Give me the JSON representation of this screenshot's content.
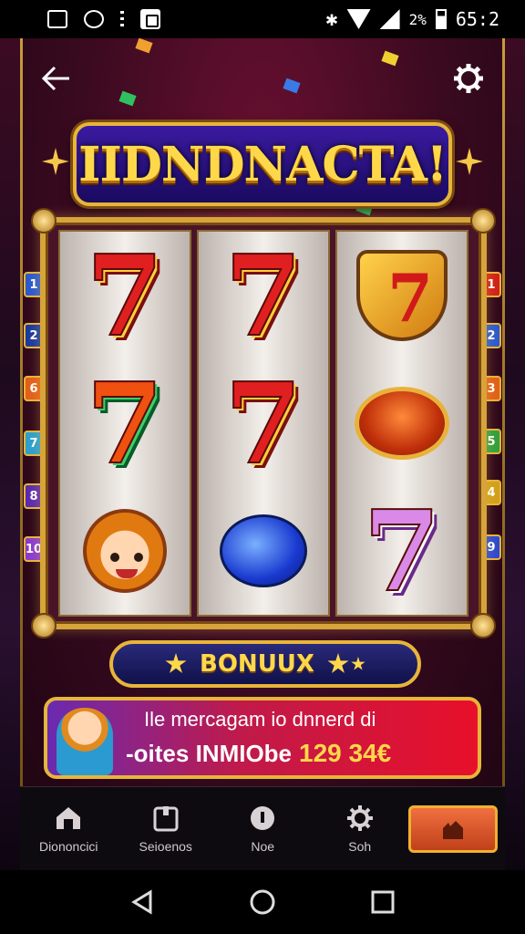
{
  "status_bar": {
    "battery_percent": "2%",
    "time": "65:2"
  },
  "game": {
    "title": "IIDNDNACTA!",
    "bonus_label": "BONUUX",
    "banner": {
      "line1": "Ile mercagam io dnnerd di",
      "line2": "-oites INMIObe",
      "amount": "129 34€"
    },
    "side_numbers_left": [
      "1",
      "2",
      "6",
      "7",
      "8",
      "10"
    ],
    "side_numbers_right": [
      "1",
      "2",
      "3",
      "5",
      "4",
      "9"
    ],
    "reels": [
      [
        "seven-red-symbol",
        "seven-green-symbol",
        "girl-symbol"
      ],
      [
        "seven-red-symbol",
        "seven-red-symbol",
        "potion-blue-symbol"
      ],
      [
        "card-shield-symbol",
        "drum-symbol",
        "seven-pink-symbol"
      ]
    ]
  },
  "bottom_nav": {
    "items": [
      {
        "label": "Diononcici",
        "icon": "home-icon"
      },
      {
        "label": "Seioenos",
        "icon": "wallet-icon"
      },
      {
        "label": "Noe",
        "icon": "coin-icon"
      },
      {
        "label": "Soh",
        "icon": "gear-icon"
      }
    ],
    "cta_icon": "hand-icon"
  },
  "colors": {
    "gold": "#e7b53a",
    "title": "#ffd84a",
    "banner_red": "#e8102a",
    "background": "#3a0a20"
  }
}
